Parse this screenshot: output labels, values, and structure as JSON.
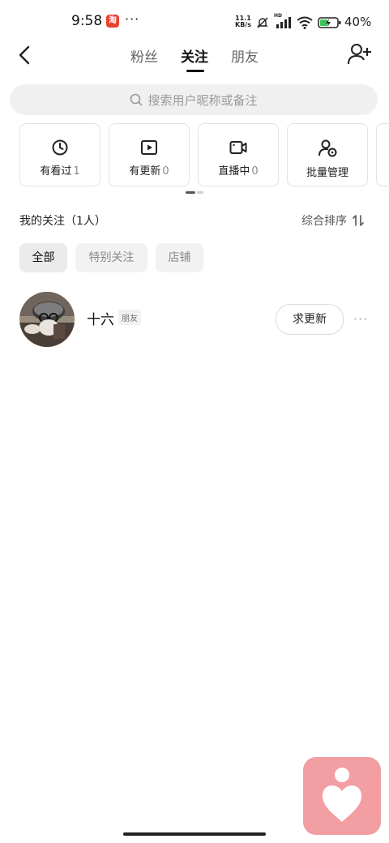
{
  "status": {
    "time": "9:58",
    "badge": "淘",
    "more": "···",
    "net_speed_value": "11.1",
    "net_speed_unit": "KB/s",
    "signal_label": "HD",
    "battery_percent": "40%"
  },
  "header": {
    "tabs": [
      {
        "label": "粉丝"
      },
      {
        "label": "关注",
        "active": true
      },
      {
        "label": "朋友"
      }
    ]
  },
  "search": {
    "placeholder": "搜索用户昵称或备注"
  },
  "cards": [
    {
      "label": "有看过",
      "count": "1",
      "icon": "clock-icon"
    },
    {
      "label": "有更新",
      "count": "0",
      "icon": "play-icon"
    },
    {
      "label": "直播中",
      "count": "0",
      "icon": "video-camera-icon"
    },
    {
      "label": "批量管理",
      "count": "",
      "icon": "user-settings-icon"
    }
  ],
  "section": {
    "title": "我的关注（1人）",
    "sort_label": "综合排序"
  },
  "filters": [
    {
      "label": "全部",
      "active": true
    },
    {
      "label": "特别关注"
    },
    {
      "label": "店铺"
    }
  ],
  "users": [
    {
      "name": "十六",
      "tag": "朋友",
      "action": "求更新",
      "more": "···"
    }
  ],
  "colors": {
    "accent_pink": "#f29ea2",
    "text_primary": "#111111",
    "search_bg": "#f0f0f0"
  }
}
